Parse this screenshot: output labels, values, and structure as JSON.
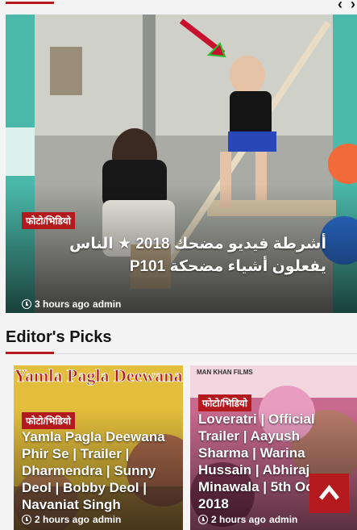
{
  "slider": {
    "prev_icon": "chevron-left-icon",
    "next_icon": "chevron-right-icon",
    "prev_glyph": "‹",
    "next_glyph": "›"
  },
  "hero": {
    "category": "फोटो/भिडियो",
    "title": "أشرطة فيديو مضحك 2018 ★ الناس يفعلون أشياء مضحكة P101",
    "time": "3 hours ago",
    "author": "admin"
  },
  "section": {
    "title": "Editor's Picks"
  },
  "cards": [
    {
      "category": "फोटो/भिडियो",
      "title": "Yamla Pagla Deewana Phir Se | Trailer | Dharmendra | Sunny Deol | Bobby Deol | Navaniat Singh",
      "time": "2 hours ago",
      "author": "admin",
      "poster_text": "Yamla Pagla Deewana"
    },
    {
      "category": "फोटो/भिडियो",
      "title": "Loveratri | Official Trailer | Aayush Sharma | Warina Hussain | Abhiraj Minawala | 5th October 2018",
      "time": "2 hours ago",
      "author": "admin",
      "poster_text": "MAN KHAN FILMS"
    }
  ],
  "colors": {
    "accent": "#b4191d"
  }
}
